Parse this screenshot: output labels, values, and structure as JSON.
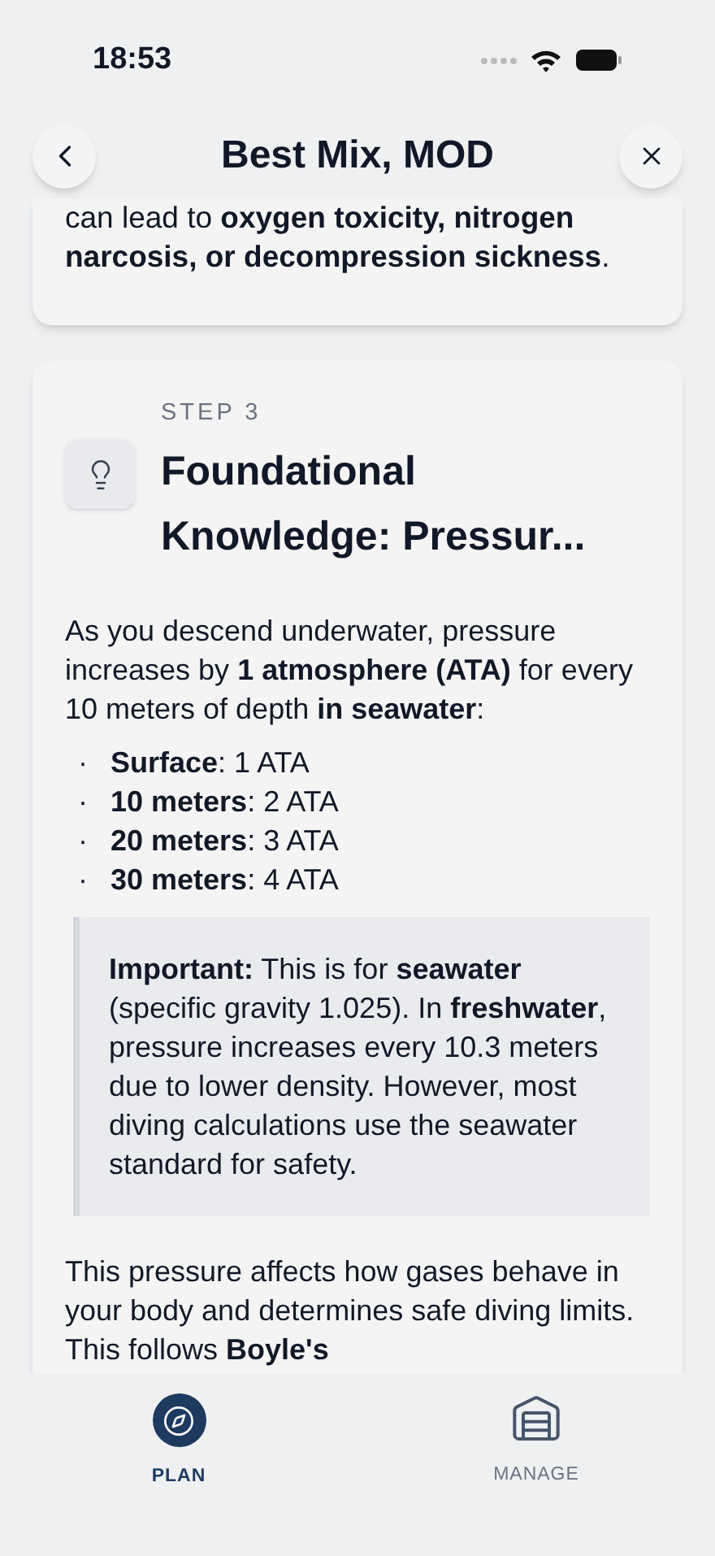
{
  "status_bar": {
    "time": "18:53"
  },
  "header": {
    "title": "Best Mix, MOD"
  },
  "previous_card": {
    "text": "can lead to **oxygen toxicity, nitrogen narcosis, or decompression sickness**."
  },
  "step_card": {
    "step": "STEP 3",
    "title": "Foundational Knowledge: Pressur...",
    "intro": "As you descend underwater, pressure increases by **1 atmosphere (ATA)** for every 10 meters of depth **in seawater**:",
    "bullets": [
      {
        "marker": "·",
        "text": "**Surface**: 1 ATA"
      },
      {
        "marker": "·",
        "text": "**10 meters**: 2 ATA"
      },
      {
        "marker": "·",
        "text": "**20 meters**: 3 ATA"
      },
      {
        "marker": "·",
        "text": "**30 meters**: 4 ATA"
      }
    ],
    "callout": "**Important:** This is for **seawater** (specific gravity 1.025). In **freshwater**, pressure increases every 10.3 meters due to lower density. However, most diving calculations use the seawater standard for safety.",
    "outro": "This pressure affects how gases behave in your body and determines safe diving limits. This follows **Boyle's**"
  },
  "tab_bar": [
    {
      "label": "PLAN",
      "kind": "plan",
      "selected": true
    },
    {
      "label": "MANAGE",
      "kind": "manage",
      "selected": false
    }
  ]
}
